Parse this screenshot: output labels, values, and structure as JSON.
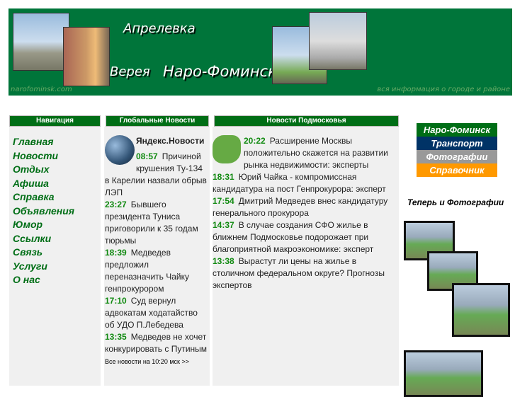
{
  "banner": {
    "town1": "Апрелевка",
    "town2": "Верея",
    "town3": "Наро-Фоминск",
    "site": "narofominsk.com",
    "tagline": "вся информация о городе и районе"
  },
  "headers": {
    "nav": "Навигация",
    "global": "Глобальные Новости",
    "regional": "Новости Подмосковья"
  },
  "nav": [
    "Главная",
    "Новости",
    "Отдых",
    "Афиша",
    "Справка",
    "Объявления",
    "Юмор",
    "Ссылки",
    "Связь",
    "Услуги",
    "О нас"
  ],
  "global": {
    "source": "Яндекс.Новости",
    "items": [
      {
        "time": "08:57",
        "text": "Причиной крушения Ту-134 в Карелии назвали обрыв ЛЭП"
      },
      {
        "time": "23:27",
        "text": "Бывшего президента Туниса приговорили к 35 годам тюрьмы"
      },
      {
        "time": "18:39",
        "text": "Медведев предложил переназначить Чайку генпрокурором"
      },
      {
        "time": "17:10",
        "text": "Суд вернул адвокатам ходатайство об УДО П.Лебедева"
      },
      {
        "time": "13:35",
        "text": "Медведев не хочет конкурировать с Путиным"
      }
    ],
    "all": "Все новости на 10:20 мск >>"
  },
  "regional": [
    {
      "time": "20:22",
      "text": "Расширение Москвы положительно скажется на развитии рынка недвижимости: эксперты"
    },
    {
      "time": "18:31",
      "text": "Юрий Чайка - компромиссная кандидатура на пост Генпрокурора: эксперт"
    },
    {
      "time": "17:54",
      "text": "Дмитрий Медведев внес кандидатуру генерального прокурора"
    },
    {
      "time": "14:37",
      "text": "В случае создания СФО жилье в ближнем Подмосковье подорожает при благоприятной макроэкономике: эксперт"
    },
    {
      "time": "13:38",
      "text": "Вырастут ли цены на жилье в столичном федеральном округе? Прогнозы экспертов"
    }
  ],
  "right": {
    "buttons": [
      {
        "label": "Наро-Фоминск",
        "color": "#006e16"
      },
      {
        "label": "Транспорт",
        "color": "#003366"
      },
      {
        "label": "Фотографии",
        "color": "#999999"
      },
      {
        "label": "Справочник",
        "color": "#ff9900"
      }
    ],
    "photos_title": "Теперь и Фотографии"
  }
}
